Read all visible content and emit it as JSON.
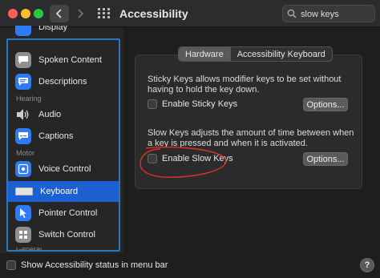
{
  "window": {
    "title": "Accessibility"
  },
  "search": {
    "value": "slow keys",
    "icon": "search-icon"
  },
  "sidebar": {
    "items": [
      {
        "label": "Display",
        "icon": "display-icon",
        "color": "#2f7bf5"
      },
      {
        "label": "Spoken Content",
        "icon": "speech-bubble-icon",
        "color": "#8e8e93"
      },
      {
        "label": "Descriptions",
        "icon": "descriptions-icon",
        "color": "#2f7bf5"
      },
      {
        "label": "Audio",
        "icon": "speaker-icon",
        "color": "#8e8e93"
      },
      {
        "label": "Captions",
        "icon": "captions-icon",
        "color": "#2f7bf5"
      },
      {
        "label": "Voice Control",
        "icon": "voice-control-icon",
        "color": "#2f7bf5"
      },
      {
        "label": "Keyboard",
        "icon": "keyboard-icon",
        "color": "#d8d8d8"
      },
      {
        "label": "Pointer Control",
        "icon": "pointer-icon",
        "color": "#2f7bf5"
      },
      {
        "label": "Switch Control",
        "icon": "switch-control-icon",
        "color": "#8e8e93"
      }
    ],
    "sections": {
      "hearing": "Hearing",
      "motor": "Motor",
      "general": "General"
    },
    "selected": "Keyboard"
  },
  "tabs": {
    "hardware": "Hardware",
    "accessibility_keyboard": "Accessibility Keyboard",
    "active": "Hardware"
  },
  "sticky": {
    "description": "Sticky Keys allows modifier keys to be set without having to hold the key down.",
    "checkbox_label": "Enable Sticky Keys",
    "checked": false,
    "options_label": "Options..."
  },
  "slow": {
    "description": "Slow Keys adjusts the amount of time between when a key is pressed and when it is activated.",
    "checkbox_label": "Enable Slow Keys",
    "checked": false,
    "options_label": "Options..."
  },
  "bottom": {
    "status_label": "Show Accessibility status in menu bar",
    "checked": false,
    "help_label": "?"
  },
  "colors": {
    "accent": "#1b5fd1",
    "annotation": "#e0302a",
    "outline": "#2c78c0"
  }
}
